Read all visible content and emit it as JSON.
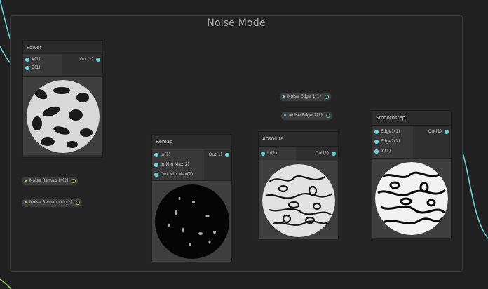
{
  "group": {
    "title": "Noise Mode"
  },
  "colors": {
    "accent_teal": "#6fd3d9",
    "accent_green": "#9ad86a",
    "background": "#202020"
  },
  "nodes": {
    "power": {
      "title": "Power",
      "inputs": [
        "A(1)",
        "B(1)"
      ],
      "output": "Out(1)"
    },
    "remap": {
      "title": "Remap",
      "inputs": [
        "In(1)",
        "In Min Max(2)",
        "Out Min Max(2)"
      ],
      "output": "Out(1)"
    },
    "absolute": {
      "title": "Absolute",
      "inputs": [
        "In(1)"
      ],
      "output": "Out(1)"
    },
    "smoothstep": {
      "title": "Smoothstep",
      "inputs": [
        "Edge1(1)",
        "Edge2(1)",
        "In(1)"
      ],
      "output": "Out(1)"
    }
  },
  "properties": {
    "noise_remap_in": "Noise Remap In(2)",
    "noise_remap_out": "Noise Remap Out(2)",
    "noise_edge_1": "Noise Edge 1(1)",
    "noise_edge_2": "Noise Edge 2(1)"
  }
}
